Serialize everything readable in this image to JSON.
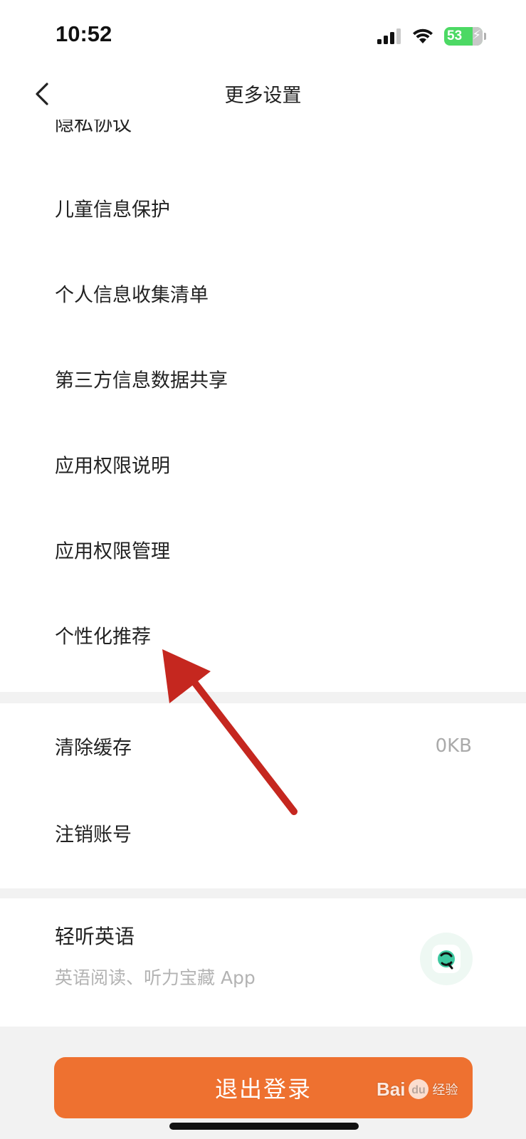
{
  "status_bar": {
    "time": "10:52",
    "battery": "53"
  },
  "nav": {
    "title": "更多设置"
  },
  "menu": {
    "partial_item": "隐私协议",
    "items": [
      {
        "label": "儿童信息保护"
      },
      {
        "label": "个人信息收集清单"
      },
      {
        "label": "第三方信息数据共享"
      },
      {
        "label": "应用权限说明"
      },
      {
        "label": "应用权限管理"
      },
      {
        "label": "个性化推荐"
      }
    ]
  },
  "storage": {
    "clear_cache_label": "清除缓存",
    "cache_size": "0KB",
    "delete_account_label": "注销账号"
  },
  "promo": {
    "title": "轻听英语",
    "subtitle": "英语阅读、听力宝藏 App"
  },
  "logout_label": "退出登录",
  "watermark": {
    "brand": "Bai",
    "brand_paw": "du",
    "product": "经验"
  },
  "colors": {
    "accent": "#ee7130",
    "annotation_arrow": "#c5271f",
    "secondary_text": "#aaaaaa",
    "battery": "#4cd964"
  }
}
